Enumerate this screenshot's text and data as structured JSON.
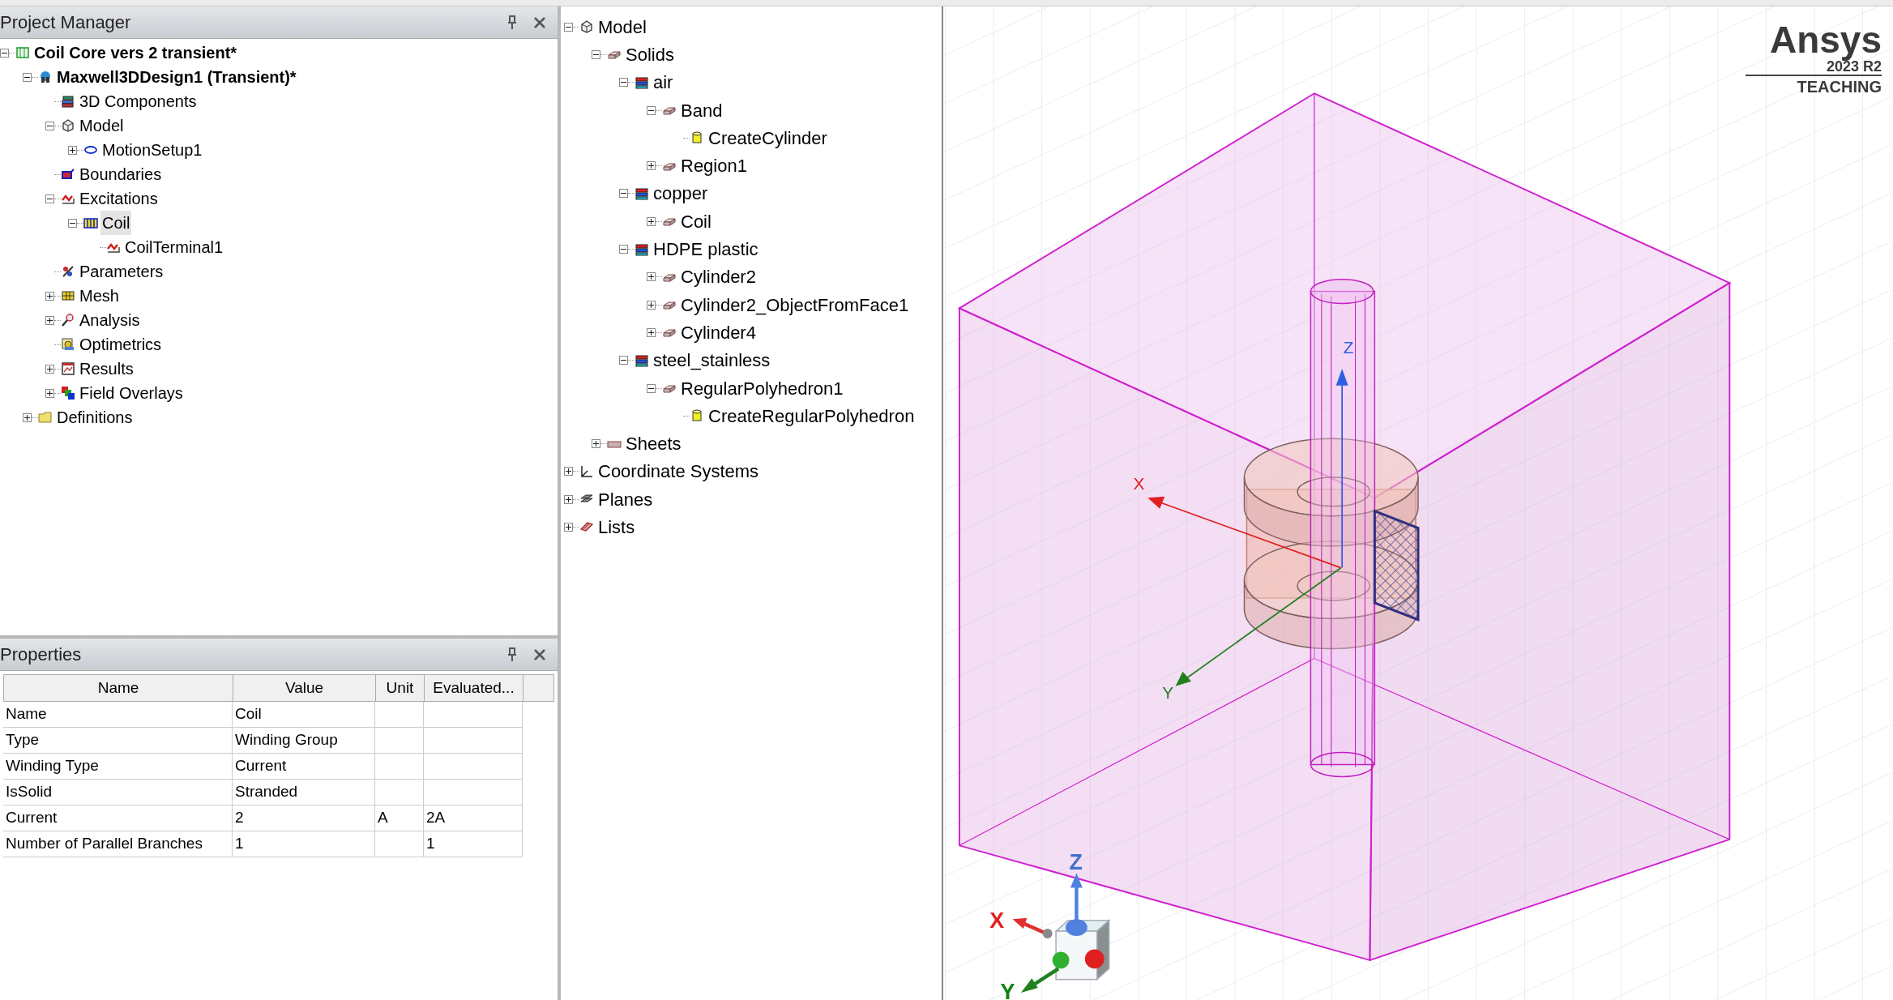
{
  "project_manager": {
    "title": "Project Manager",
    "tree": [
      {
        "label": "Coil Core vers 2 transient*",
        "kind": "project",
        "expanded": true,
        "selected": false,
        "children": [
          {
            "label": "Maxwell3DDesign1 (Transient)*",
            "kind": "design",
            "expanded": true,
            "selected": false,
            "children": [
              {
                "label": "3D Components",
                "kind": "components",
                "selected": false
              },
              {
                "label": "Model",
                "kind": "model",
                "expanded": true,
                "selected": false,
                "children": [
                  {
                    "label": "MotionSetup1",
                    "kind": "motion",
                    "expanded": false,
                    "selected": false
                  }
                ]
              },
              {
                "label": "Boundaries",
                "kind": "boundaries",
                "selected": false
              },
              {
                "label": "Excitations",
                "kind": "excitation",
                "expanded": true,
                "selected": false,
                "children": [
                  {
                    "label": "Coil",
                    "kind": "coil",
                    "expanded": true,
                    "selected": true,
                    "children": [
                      {
                        "label": "CoilTerminal1",
                        "kind": "excitation",
                        "selected": false
                      }
                    ]
                  }
                ]
              },
              {
                "label": "Parameters",
                "kind": "parameters",
                "selected": false
              },
              {
                "label": "Mesh",
                "kind": "mesh",
                "expanded": false,
                "selected": false
              },
              {
                "label": "Analysis",
                "kind": "analysis",
                "expanded": false,
                "selected": false
              },
              {
                "label": "Optimetrics",
                "kind": "optimetrics",
                "selected": false
              },
              {
                "label": "Results",
                "kind": "results",
                "expanded": false,
                "selected": false
              },
              {
                "label": "Field Overlays",
                "kind": "overlays",
                "expanded": false,
                "selected": false
              }
            ]
          },
          {
            "label": "Definitions",
            "kind": "folder",
            "expanded": false,
            "selected": false
          }
        ]
      }
    ]
  },
  "properties": {
    "title": "Properties",
    "columns": [
      "Name",
      "Value",
      "Unit",
      "Evaluated..."
    ],
    "rows": [
      {
        "name": "Name",
        "value": "Coil"
      },
      {
        "name": "Type",
        "value": "Winding Group"
      },
      {
        "name": "Winding Type",
        "value": "Current"
      },
      {
        "name": "IsSolid",
        "value": "Stranded"
      },
      {
        "name": "Current",
        "value": "2",
        "unit": "A",
        "evaluated": "2A"
      },
      {
        "name": "Number of Parallel Branches",
        "value": "1",
        "evaluated": "1"
      }
    ]
  },
  "model_tree": [
    {
      "label": "Model",
      "kind": "model",
      "expanded": true,
      "children": [
        {
          "label": "Solids",
          "kind": "solid",
          "expanded": true,
          "children": [
            {
              "label": "air",
              "kind": "material",
              "expanded": true,
              "children": [
                {
                  "label": "Band",
                  "kind": "solid",
                  "expanded": true,
                  "children": [
                    {
                      "label": "CreateCylinder",
                      "kind": "cylinder"
                    }
                  ]
                },
                {
                  "label": "Region1",
                  "kind": "solid",
                  "expanded": false
                }
              ]
            },
            {
              "label": "copper",
              "kind": "material",
              "expanded": true,
              "children": [
                {
                  "label": "Coil",
                  "kind": "solid",
                  "expanded": false
                }
              ]
            },
            {
              "label": "HDPE plastic",
              "kind": "material",
              "expanded": true,
              "children": [
                {
                  "label": "Cylinder2",
                  "kind": "solid",
                  "expanded": false
                },
                {
                  "label": "Cylinder2_ObjectFromFace1",
                  "kind": "solid",
                  "expanded": false
                },
                {
                  "label": "Cylinder4",
                  "kind": "solid",
                  "expanded": false
                }
              ]
            },
            {
              "label": "steel_stainless",
              "kind": "material",
              "expanded": true,
              "children": [
                {
                  "label": "RegularPolyhedron1",
                  "kind": "solid",
                  "expanded": true,
                  "children": [
                    {
                      "label": "CreateRegularPolyhedron",
                      "kind": "cylinder"
                    }
                  ]
                }
              ]
            }
          ]
        },
        {
          "label": "Sheets",
          "kind": "sheet",
          "expanded": false
        }
      ]
    },
    {
      "label": "Coordinate Systems",
      "kind": "axes",
      "expanded": false
    },
    {
      "label": "Planes",
      "kind": "planes",
      "expanded": false
    },
    {
      "label": "Lists",
      "kind": "lists",
      "expanded": false
    }
  ],
  "viewport": {
    "logo": {
      "brand": "Ansys",
      "version": "2023 R2",
      "edition": "TEACHING"
    },
    "axis_labels": {
      "x": "X",
      "y": "Y",
      "z": "Z"
    },
    "triad_labels": {
      "x": "X",
      "y": "Y",
      "z": "Z"
    }
  }
}
